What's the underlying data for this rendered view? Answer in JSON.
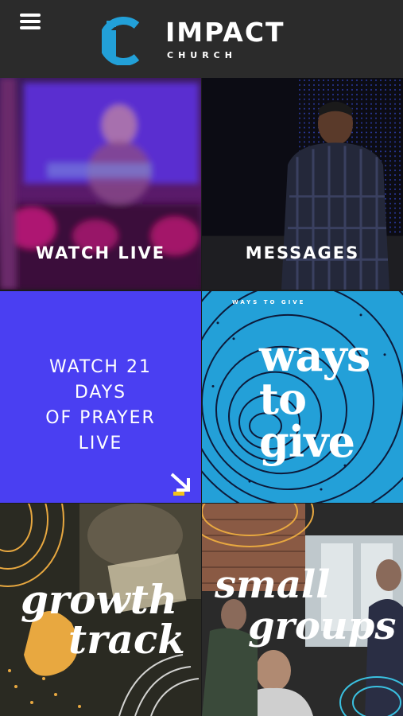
{
  "header": {
    "menu_icon": "hamburger-menu-icon",
    "logo": {
      "word": "IMPACT",
      "sub": "CHURCH",
      "mark_color": "#22a0d8"
    }
  },
  "tiles": [
    {
      "id": "watch-live",
      "label": "WATCH LIVE"
    },
    {
      "id": "messages",
      "label": "MESSAGES"
    },
    {
      "id": "prayer",
      "lines": [
        "WATCH 21",
        "DAYS",
        "OF PRAYER",
        "LIVE"
      ],
      "icon": "arrow-down-right-icon",
      "bg": "#4a3ff2"
    },
    {
      "id": "ways-to-give",
      "title": [
        "ways",
        "to",
        "give"
      ],
      "corner_small": "WAYS TO GIVE",
      "bg": "#23a0d8"
    },
    {
      "id": "growth-track",
      "title": [
        "growth",
        "track"
      ]
    },
    {
      "id": "small-groups",
      "title": [
        "small",
        "groups"
      ]
    }
  ]
}
